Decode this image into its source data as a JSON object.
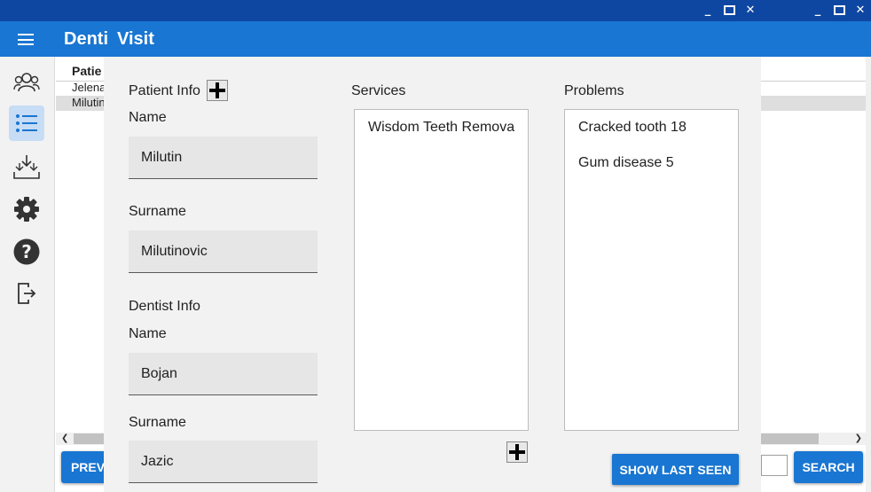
{
  "app": {
    "title": "Denti"
  },
  "dialog": {
    "title": "Visit",
    "patient_info_label": "Patient Info",
    "patient_name_label": "Name",
    "patient_name_value": "Milutin",
    "patient_surname_label": "Surname",
    "patient_surname_value": "Milutinovic",
    "dentist_info_label": "Dentist Info",
    "dentist_name_label": "Name",
    "dentist_name_value": "Bojan",
    "dentist_surname_label": "Surname",
    "dentist_surname_value": "Jazic",
    "services_label": "Services",
    "services": [
      "Wisdom Teeth Remova"
    ],
    "problems_label": "Problems",
    "problems": [
      "Cracked tooth 18",
      "Gum disease 5"
    ],
    "show_last_seen_label": "SHOW LAST SEEN"
  },
  "table": {
    "header": "Patie",
    "rows": [
      "Jelena",
      "Milutin"
    ]
  },
  "outer_buttons": {
    "prev_label": "PREV",
    "search_label": "SEARCH"
  },
  "sidebar": {
    "items": [
      "patients-icon",
      "list-icon",
      "download-icon",
      "settings-icon",
      "help-icon",
      "logout-icon"
    ]
  },
  "colors": {
    "primary": "#1976d2",
    "titlebar": "#0d47a1",
    "active_nav": "#c7dcf5"
  }
}
